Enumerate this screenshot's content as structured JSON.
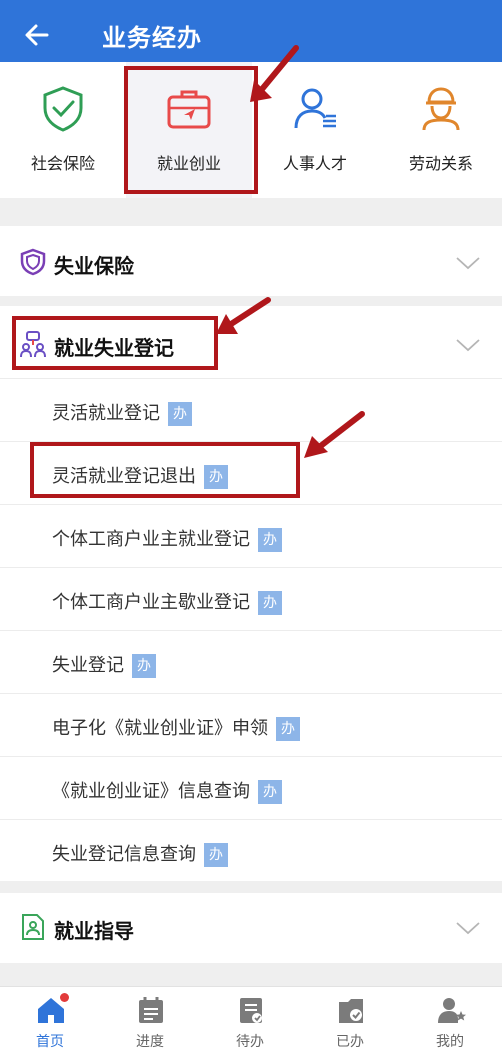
{
  "header": {
    "title": "业务经办",
    "back_icon": "back-arrow-icon"
  },
  "categories": [
    {
      "label": "社会保险",
      "icon": "shield-check-icon",
      "color": "#2f9e55"
    },
    {
      "label": "就业创业",
      "icon": "briefcase-icon",
      "color": "#e84a4a",
      "active": true
    },
    {
      "label": "人事人才",
      "icon": "user-id-icon",
      "color": "#2f74d9"
    },
    {
      "label": "劳动关系",
      "icon": "worker-helmet-icon",
      "color": "#e0862c"
    }
  ],
  "sections": {
    "unemployment_insurance": {
      "title": "失业保险",
      "icon": "purple-shield-icon"
    },
    "registration": {
      "title": "就业失业登记",
      "icon": "people-network-icon",
      "badge_label": "办",
      "items": [
        {
          "label": "灵活就业登记"
        },
        {
          "label": "灵活就业登记退出"
        },
        {
          "label": "个体工商户业主就业登记"
        },
        {
          "label": "个体工商户业主歇业登记"
        },
        {
          "label": "失业登记"
        },
        {
          "label": "电子化《就业创业证》申领"
        },
        {
          "label": "《就业创业证》信息查询"
        },
        {
          "label": "失业登记信息查询"
        }
      ]
    },
    "guidance": {
      "title": "就业指导",
      "icon": "doc-person-icon"
    }
  },
  "tabs": [
    {
      "label": "首页",
      "icon": "home-icon",
      "active": true
    },
    {
      "label": "进度",
      "icon": "calendar-list-icon"
    },
    {
      "label": "待办",
      "icon": "todo-doc-icon"
    },
    {
      "label": "已办",
      "icon": "done-doc-icon"
    },
    {
      "label": "我的",
      "icon": "user-star-icon"
    }
  ],
  "colors": {
    "primary": "#2f74d9",
    "annotation": "#b0171b",
    "badge": "#8db5e8"
  }
}
